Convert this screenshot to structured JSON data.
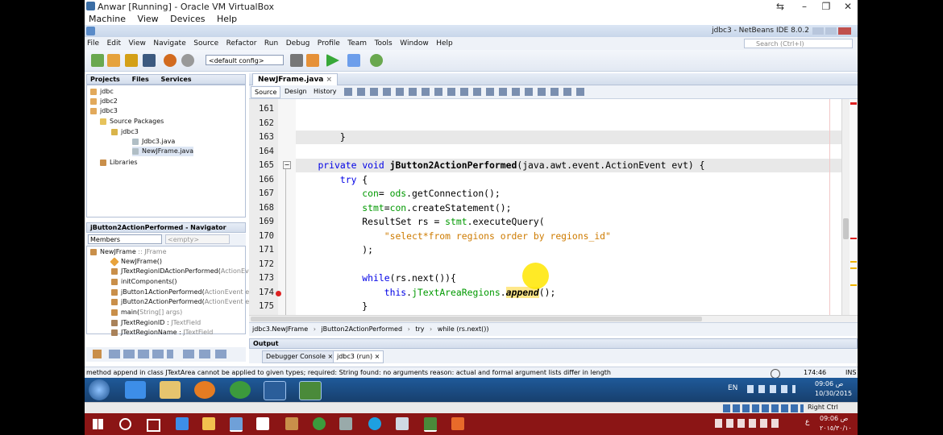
{
  "vbox": {
    "title": "Anwar [Running] - Oracle VM VirtualBox",
    "menu": [
      "Machine",
      "View",
      "Devices",
      "Help"
    ],
    "controls": [
      "⇆",
      "–",
      "❐",
      "✕"
    ]
  },
  "netbeans": {
    "title_right": "jdbc3 - NetBeans IDE 8.0.2",
    "menu": [
      "File",
      "Edit",
      "View",
      "Navigate",
      "Source",
      "Refactor",
      "Run",
      "Debug",
      "Profile",
      "Team",
      "Tools",
      "Window",
      "Help"
    ],
    "search_placeholder": "Search (Ctrl+I)",
    "config": "<default config>"
  },
  "projects": {
    "tabs": [
      "Projects",
      "Files",
      "Services"
    ],
    "tree": [
      {
        "label": "jdbc",
        "level": 0
      },
      {
        "label": "jdbc2",
        "level": 0
      },
      {
        "label": "jdbc3",
        "level": 0
      },
      {
        "label": "Source Packages",
        "level": 1
      },
      {
        "label": "jdbc3",
        "level": 2
      },
      {
        "label": "Jdbc3.java",
        "level": 3
      },
      {
        "label": "NewJFrame.java",
        "level": 3
      },
      {
        "label": "Libraries",
        "level": 1
      }
    ]
  },
  "navigator": {
    "title": "jButton2ActionPerformed - Navigator",
    "filter": "Members",
    "filter2": "<empty>",
    "items": [
      {
        "name": "NewJFrame",
        "type": " :: JFrame"
      },
      {
        "name": "NewJFrame()",
        "type": ""
      },
      {
        "name": "JTextRegionIDActionPerformed(",
        "type": "ActionEve"
      },
      {
        "name": "initComponents()",
        "type": ""
      },
      {
        "name": "jButton1ActionPerformed(",
        "type": "ActionEvent evt"
      },
      {
        "name": "jButton2ActionPerformed(",
        "type": "ActionEvent evt"
      },
      {
        "name": "main(",
        "type": "String[] args)"
      },
      {
        "name": "JTextRegionID : ",
        "type": "JTextField"
      },
      {
        "name": "JTextRegionName : ",
        "type": "JTextField"
      }
    ]
  },
  "editor": {
    "tab": "NewJFrame.java",
    "modes": [
      "Source",
      "Design",
      "History"
    ],
    "lines": [
      {
        "n": "161",
        "code": ""
      },
      {
        "n": "162",
        "code": ""
      },
      {
        "n": "163",
        "code": "        }"
      },
      {
        "n": "164",
        "code": ""
      },
      {
        "n": "165",
        "code": "    private void jButton2ActionPerformed(java.awt.event.ActionEvent evt) {"
      },
      {
        "n": "166",
        "code": "        try {"
      },
      {
        "n": "167",
        "code": "            con= ods.getConnection();"
      },
      {
        "n": "168",
        "code": "            stmt=con.createStatement();"
      },
      {
        "n": "169",
        "code": "            ResultSet rs = stmt.executeQuery("
      },
      {
        "n": "170",
        "code": "                \"select*from regions order by regions_id\""
      },
      {
        "n": "171",
        "code": "            );"
      },
      {
        "n": "172",
        "code": ""
      },
      {
        "n": "173",
        "code": "            while(rs.next()){"
      },
      {
        "n": "174",
        "code": "                this.jTextAreaRegions.append();"
      },
      {
        "n": "175",
        "code": "            }"
      }
    ]
  },
  "breadcrumb": [
    "jdbc3.NewJFrame",
    "jButton2ActionPerformed",
    "try",
    "while (rs.next())"
  ],
  "output": {
    "title": "Output",
    "tabs": [
      "Debugger Console",
      "jdbc3 (run)"
    ]
  },
  "status": {
    "message": "method append in class JTextArea cannot be applied to given types;  required: String  found: no arguments  reason: actual and formal argument lists differ in length",
    "position": "174:46",
    "mode": "INS"
  },
  "guest_tray": {
    "lang": "EN",
    "time": "09:06",
    "ampm": "ص",
    "date": "10/30/2015"
  },
  "vbox_status": {
    "hostkey": "Right Ctrl"
  },
  "host_tray": {
    "time": "09:06",
    "ampm": "ص",
    "date": "٢٠١٥/٣٠/١٠",
    "lang": "ع"
  }
}
